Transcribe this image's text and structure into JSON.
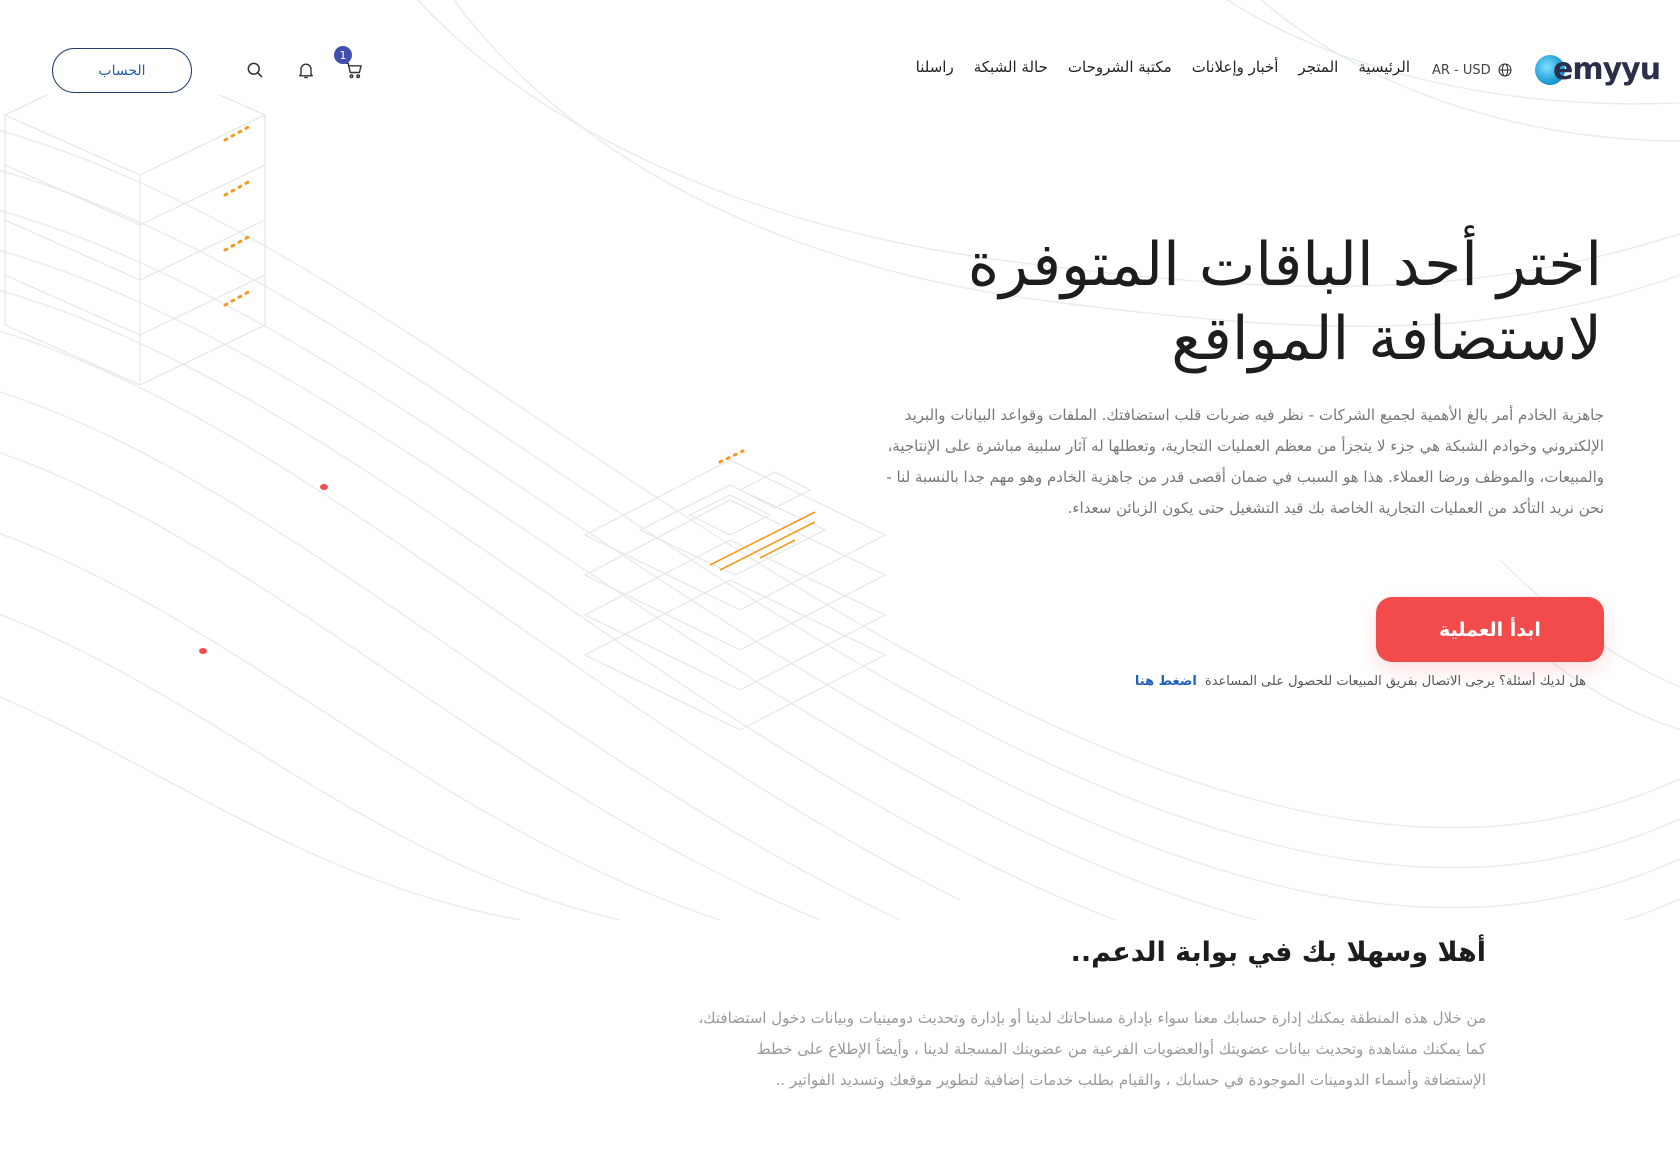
{
  "brand": {
    "logo_text": "emyyu"
  },
  "locale": {
    "label": "AR - USD"
  },
  "nav": {
    "items": [
      {
        "label": "الرئيسية"
      },
      {
        "label": "المتجر"
      },
      {
        "label": "أخبار وإعلانات"
      },
      {
        "label": "مكتبة الشروحات"
      },
      {
        "label": "حالة الشبكة"
      },
      {
        "label": "راسلنا"
      }
    ]
  },
  "header": {
    "cart_count": "1",
    "account_label": "الحساب"
  },
  "hero": {
    "title_line1": "اختر أحد الباقات المتوفرة",
    "title_line2": "لاستضافة المواقع",
    "description": "جاهزية الخادم أمر بالغ الأهمية لجميع الشركات - نظر فيه ضربات قلب استضافتك. الملفات وقواعد البيانات والبريد الإلكتروني وخوادم الشبكة هي جزء لا يتجزأ من معظم العمليات التجارية، وتعطلها له آثار سلبية مباشرة على الإنتاجية، والمبيعات، والموظف ورضا العملاء. هذا هو السبب في ضمان أقصى قدر من جاهزية الخادم وهو مهم جدا بالنسبة لنا - نحن نريد التأكد من العمليات التجارية الخاصة بك قيد التشغيل حتى يكون الزبائن سعداء.",
    "cta_label": "ابدأ العملية",
    "help_text": "هل لديك أسئلة؟ يرجى الاتصال بفريق المبيعات للحصول على المساعدة",
    "help_link": "اضغط هنا"
  },
  "welcome": {
    "title": "أهلا وسهلا بك في بوابة الدعم..",
    "description": "من خلال هذه المنطقة يمكنك إدارة حسابك معنا سواء بإدارة مساحاتك لدينا أو بإدارة وتحديث دومينيات وبيانات دخول استضافتك، كما يمكنك مشاهدة وتحديث بيانات عضويتك أوالعضويات الفرعية من عضويتك المسجلة لدينا ، وأيضاً الإطلاع على خطط الإستضافة وأسماء الدومينات الموجودة في حسابك ، والقيام بطلب خدمات إضافية لتطوير موقعك وتسديد الفواتير .."
  },
  "colors": {
    "accent": "#f34b4b",
    "link": "#1f5fbf",
    "badge": "#3f4fb0",
    "iso_orange": "#f39a1e"
  }
}
